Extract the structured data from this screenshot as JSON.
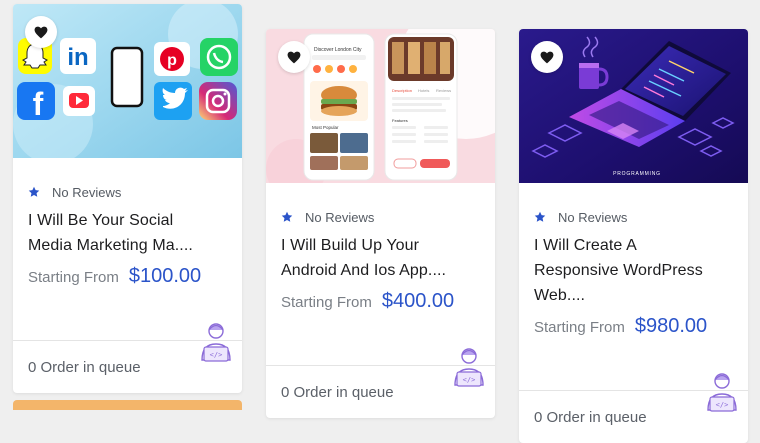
{
  "cards": [
    {
      "rating_text": "No Reviews",
      "title_line1": "I Will Be Your Social",
      "title_line2": "Media Marketing Ma....",
      "title_line3": "",
      "price_label": "Starting From",
      "price": "$100.00",
      "queue": "0 Order in queue"
    },
    {
      "rating_text": "No Reviews",
      "title_line1": "I Will Build Up Your",
      "title_line2": "Android And Ios App....",
      "title_line3": "",
      "price_label": "Starting From",
      "price": "$400.00",
      "queue": "0 Order in queue",
      "mockup": {
        "header": "Discover London City",
        "tab1": "Description",
        "tab2": "Hotels",
        "tab3": "Reviews",
        "section": "Most Popular",
        "amenities": "Features"
      }
    },
    {
      "rating_text": "No Reviews",
      "title_line1": "I Will Create A",
      "title_line2": "Responsive WordPress",
      "title_line3": "Web....",
      "price_label": "Starting From",
      "price": "$980.00",
      "queue": "0 Order in queue",
      "image_caption": "PROGRAMMING"
    }
  ],
  "colors": {
    "price": "#2b54c9",
    "star": "#2b54c9",
    "background": "#efefef"
  }
}
